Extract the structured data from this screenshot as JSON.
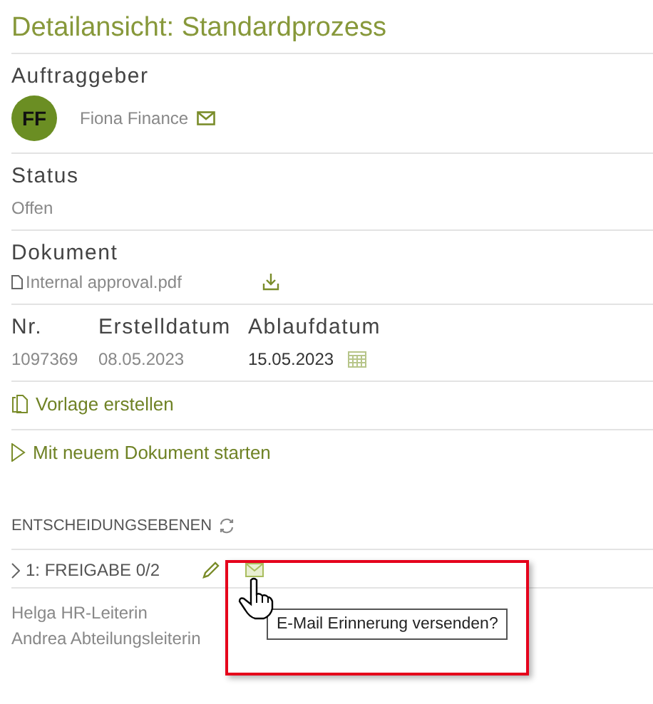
{
  "title": "Detailansicht: Standardprozess",
  "client": {
    "label": "Auftraggeber",
    "initials": "FF",
    "name": "Fiona Finance"
  },
  "status": {
    "label": "Status",
    "value": "Offen"
  },
  "document": {
    "label": "Dokument",
    "file": "Internal approval.pdf"
  },
  "fields": [
    {
      "label": "Nr.",
      "value": "1097369",
      "kind": "plain"
    },
    {
      "label": "Erstelldatum",
      "value": "08.05.2023",
      "kind": "plain"
    },
    {
      "label": "Ablaufdatum",
      "value": "15.05.2023",
      "kind": "date"
    }
  ],
  "actions": [
    {
      "kind": "template",
      "label": "Vorlage erstellen"
    },
    {
      "kind": "start",
      "label": "Mit neuem Dokument starten"
    }
  ],
  "levels": {
    "heading": "ENTSCHEIDUNGSEBENEN",
    "items": [
      {
        "title": "1: FREIGABE 0/2",
        "members": [
          "Helga HR-Leiterin",
          "Andrea Abteilungsleiterin"
        ]
      }
    ]
  },
  "tooltip": "E-Mail Erinnerung versenden?"
}
